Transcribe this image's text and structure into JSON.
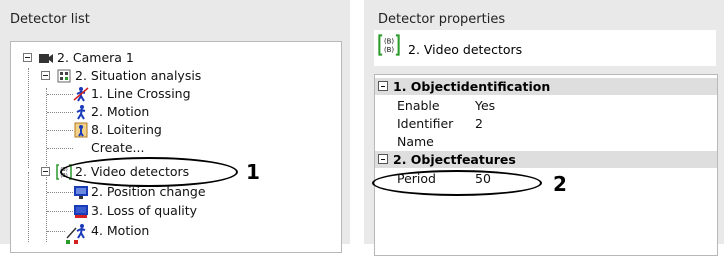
{
  "left_panel": {
    "title": "Detector list",
    "tree": [
      {
        "label": "2. Camera 1"
      },
      {
        "label": "2. Situation analysis"
      },
      {
        "label": "1. Line Crossing"
      },
      {
        "label": "2. Motion"
      },
      {
        "label": "8. Loitering"
      },
      {
        "label": "Create..."
      },
      {
        "label": "2. Video detectors"
      },
      {
        "label": "2. Position change"
      },
      {
        "label": "3. Loss of quality"
      },
      {
        "label": "4. Motion"
      }
    ]
  },
  "right_panel": {
    "title": "Detector properties",
    "selected": "2. Video detectors",
    "groups": [
      {
        "label": "1. Objectidentification"
      },
      {
        "label": "2. Objectfeatures"
      }
    ],
    "props": [
      {
        "key": "Enable",
        "value": "Yes"
      },
      {
        "key": "Identifier",
        "value": "2"
      },
      {
        "key": "Name",
        "value": ""
      },
      {
        "key": "Period",
        "value": "50"
      }
    ]
  },
  "callouts": [
    "1",
    "2"
  ],
  "colors": {
    "panel_bg": "#e9e9e9",
    "icon_green": "#2a9a2a",
    "icon_blue": "#1a3bb8",
    "icon_red": "#d42020"
  }
}
